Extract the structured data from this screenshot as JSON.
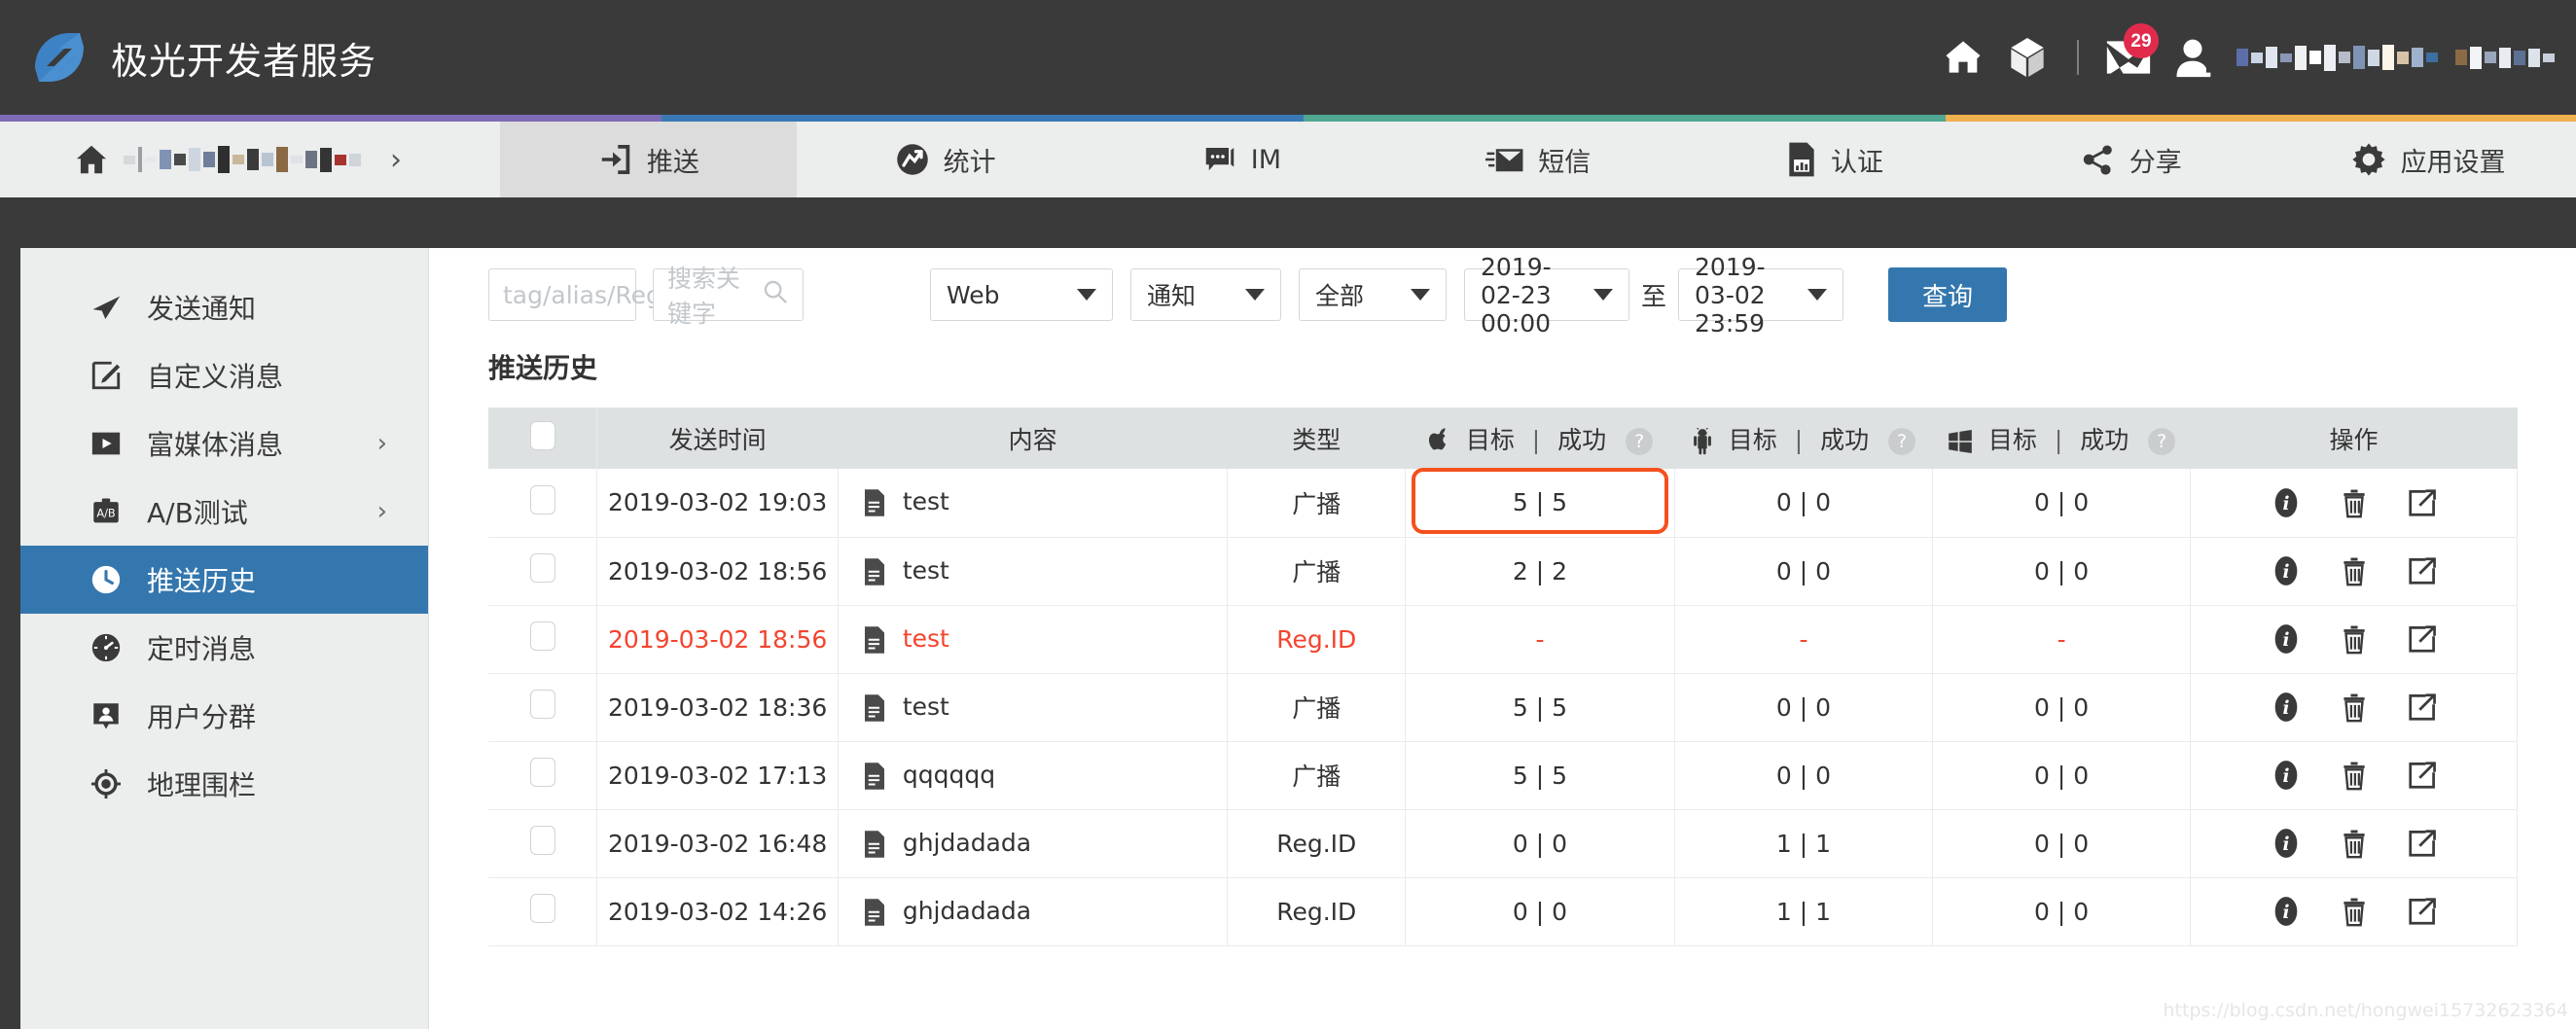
{
  "header": {
    "brand_title": "极光开发者服务",
    "logo_icon": "aurora-logo-icon",
    "icons": {
      "home": "home-icon",
      "cube": "cube-icon",
      "mail": "mail-icon",
      "user": "user-avatar-icon"
    },
    "mail_badge": "29",
    "accent_strip": [
      "#7d6cb5",
      "#3a78b5",
      "#4fa792",
      "#efb04e"
    ]
  },
  "nav": {
    "app_breadcrumb_chevron": "›",
    "tabs": [
      {
        "label": "",
        "icon": "home-icon",
        "active": false,
        "masked": true
      },
      {
        "label": "推送",
        "icon": "push-icon",
        "active": true,
        "masked": false
      },
      {
        "label": "统计",
        "icon": "stats-icon",
        "active": false,
        "masked": false
      },
      {
        "label": "IM",
        "icon": "chat-icon",
        "active": false,
        "masked": false
      },
      {
        "label": "短信",
        "icon": "sms-icon",
        "active": false,
        "masked": false
      },
      {
        "label": "认证",
        "icon": "sim-icon",
        "active": false,
        "masked": false
      },
      {
        "label": "分享",
        "icon": "share-icon",
        "active": false,
        "masked": false
      },
      {
        "label": "应用设置",
        "icon": "gear-icon",
        "active": false,
        "masked": false
      }
    ]
  },
  "sidebar": {
    "items": [
      {
        "label": "发送通知",
        "icon": "paper-plane-icon",
        "chevron": "",
        "active": false
      },
      {
        "label": "自定义消息",
        "icon": "edit-square-icon",
        "chevron": "",
        "active": false
      },
      {
        "label": "富媒体消息",
        "icon": "play-square-icon",
        "chevron": "›",
        "active": false
      },
      {
        "label": "A/B测试",
        "icon": "ab-test-icon",
        "chevron": "›",
        "active": false
      },
      {
        "label": "推送历史",
        "icon": "clock-icon",
        "chevron": "",
        "active": true
      },
      {
        "label": "定时消息",
        "icon": "timer-icon",
        "chevron": "",
        "active": false
      },
      {
        "label": "用户分群",
        "icon": "user-group-icon",
        "chevron": "",
        "active": false
      },
      {
        "label": "地理围栏",
        "icon": "geofence-icon",
        "chevron": "",
        "active": false
      }
    ],
    "active_color": "#3477ae"
  },
  "filters": {
    "tag_search_placeholder": "tag/alias/Reg.ID",
    "tag_search_value": "",
    "keyword_search_placeholder": "搜索关键字",
    "keyword_search_value": "",
    "platform_select": "Web",
    "type_select": "通知",
    "scope_select": "全部",
    "date_from": "2019-02-23 00:00",
    "date_separator": "至",
    "date_to": "2019-03-02 23:59",
    "query_button": "查询",
    "search_icon": "search-icon"
  },
  "section": {
    "title": "推送历史"
  },
  "table": {
    "columns": {
      "select_all": "",
      "time": "发送时间",
      "content": "内容",
      "type": "类型",
      "ios": {
        "icon": "apple-icon",
        "target": "目标",
        "sep": "|",
        "success": "成功",
        "help": "?"
      },
      "android": {
        "icon": "android-icon",
        "target": "目标",
        "sep": "|",
        "success": "成功",
        "help": "?"
      },
      "windows": {
        "icon": "windows-icon",
        "target": "目标",
        "sep": "|",
        "success": "成功",
        "help": "?"
      },
      "actions": "操作"
    },
    "action_icons": [
      "info-icon",
      "trash-icon",
      "external-link-icon"
    ],
    "highlight_color": "#f4501e",
    "error_color": "#f4442e",
    "rows": [
      {
        "time": "2019-03-02 19:03",
        "content": "test",
        "type": "广播",
        "ios": "5 | 5",
        "android": "0 | 0",
        "windows": "0 | 0",
        "error": false,
        "highlight_ios": true
      },
      {
        "time": "2019-03-02 18:56",
        "content": "test",
        "type": "广播",
        "ios": "2 | 2",
        "android": "0 | 0",
        "windows": "0 | 0",
        "error": false,
        "highlight_ios": false
      },
      {
        "time": "2019-03-02 18:56",
        "content": "test",
        "type": "Reg.ID",
        "ios": "-",
        "android": "-",
        "windows": "-",
        "error": true,
        "highlight_ios": false
      },
      {
        "time": "2019-03-02 18:36",
        "content": "test",
        "type": "广播",
        "ios": "5 | 5",
        "android": "0 | 0",
        "windows": "0 | 0",
        "error": false,
        "highlight_ios": false
      },
      {
        "time": "2019-03-02 17:13",
        "content": "qqqqqq",
        "type": "广播",
        "ios": "5 | 5",
        "android": "0 | 0",
        "windows": "0 | 0",
        "error": false,
        "highlight_ios": false
      },
      {
        "time": "2019-03-02 16:48",
        "content": "ghjdadada",
        "type": "Reg.ID",
        "ios": "0 | 0",
        "android": "1 | 1",
        "windows": "0 | 0",
        "error": false,
        "highlight_ios": false
      },
      {
        "time": "2019-03-02 14:26",
        "content": "ghjdadada",
        "type": "Reg.ID",
        "ios": "0 | 0",
        "android": "1 | 1",
        "windows": "0 | 0",
        "error": false,
        "highlight_ios": false
      }
    ]
  },
  "watermark": "https://blog.csdn.net/hongwei15732623364"
}
